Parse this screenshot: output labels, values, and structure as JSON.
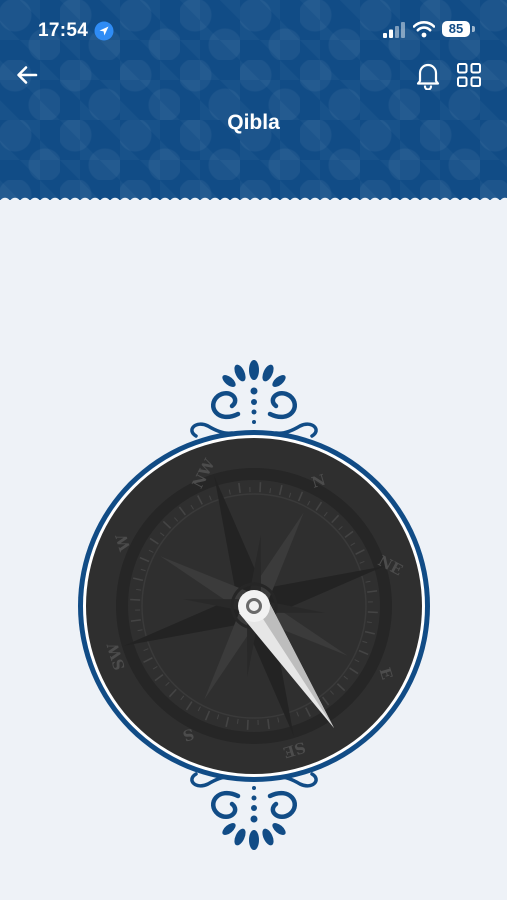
{
  "status_bar": {
    "time": "17:54",
    "battery": "85",
    "location_icon": "location-arrow-icon",
    "signal_icon": "cellular-signal-icon",
    "wifi_icon": "wifi-icon"
  },
  "header": {
    "title": "Qibla",
    "back_icon": "arrow-left-icon",
    "notification_icon": "bell-icon",
    "menu_icon": "grid-icon"
  },
  "compass": {
    "directions": [
      "N",
      "NE",
      "E",
      "SE",
      "S",
      "SW",
      "W",
      "NW"
    ]
  },
  "colors": {
    "brand": "#114c86",
    "background": "#eef2f7",
    "dial": "#2f2f2f",
    "needle": "#f2f2f2"
  }
}
